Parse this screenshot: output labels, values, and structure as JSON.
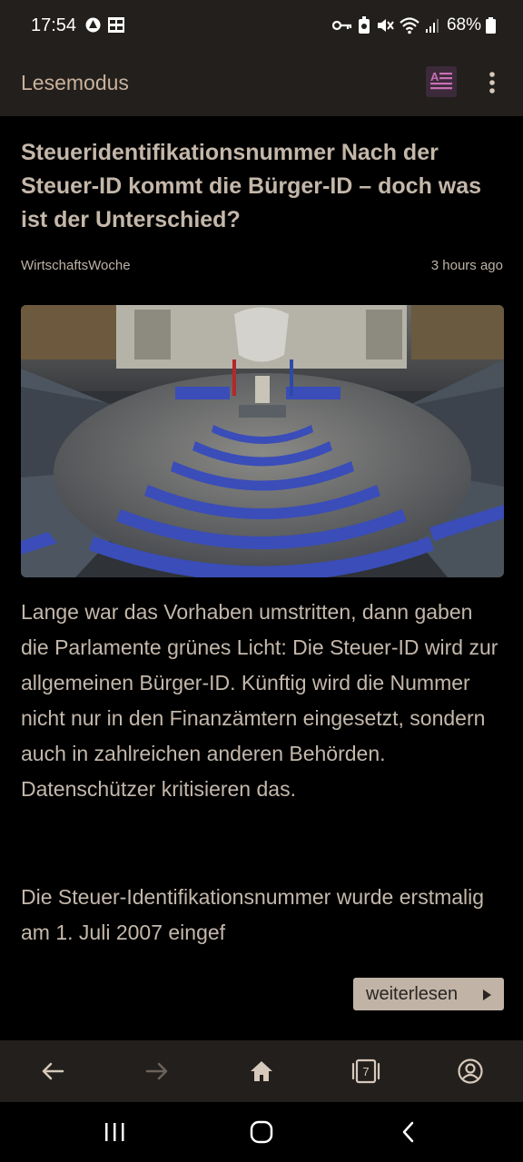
{
  "status_bar": {
    "time": "17:54",
    "battery": "68%",
    "left_icons": [
      "hotspot-icon",
      "grid-app-icon"
    ],
    "right_icons": [
      "vpn-key-icon",
      "notification-icon",
      "mute-icon",
      "wifi-icon",
      "signal-icon",
      "battery-icon"
    ]
  },
  "app_bar": {
    "title": "Lesemodus",
    "reader_icon": "reader-mode-icon",
    "menu_icon": "more-vert-icon"
  },
  "article": {
    "headline": "Steueridentifikationsnummer Nach der Steuer-ID kommt die Bürger-ID – doch was ist der Unterschied?",
    "source": "WirtschaftsWoche",
    "time": "3 hours ago",
    "paragraph1": "Lange war das Vorhaben umstritten, dann gaben die Parlamente grünes Licht: Die Steuer-ID wird zur allgemeinen Bürger-ID. Künftig wird die Nummer nicht nur in den Finanzämtern eingesetzt, sondern auch in zahlreichen anderen Behörden. Datenschützer kritisieren das.",
    "paragraph2": "Die Steuer-Identifikationsnummer wurde erstmalig am 1. Juli 2007 eingef",
    "read_more": "weiterlesen"
  },
  "browser_nav": {
    "tab_count": "7",
    "items": [
      "back-icon",
      "forward-icon",
      "home-icon",
      "tabs-icon",
      "account-icon"
    ]
  },
  "system_nav": [
    "recents-icon",
    "home-circle-icon",
    "back-chevron-icon"
  ],
  "colors": {
    "bar_background": "#221f1c",
    "accent_text": "#c9b29b",
    "reader_icon_bg": "#3c2a3a",
    "reader_icon_fg": "#c86fb4"
  }
}
